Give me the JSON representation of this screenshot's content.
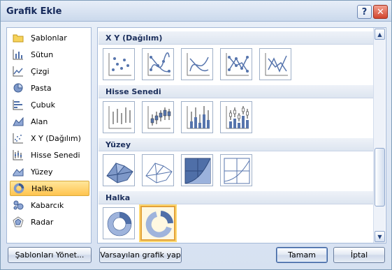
{
  "window": {
    "title": "Grafik Ekle"
  },
  "titlebar": {
    "help_glyph": "?",
    "close_glyph": "✕"
  },
  "sidebar": {
    "items": [
      {
        "label": "Şablonlar",
        "icon": "folder-icon"
      },
      {
        "label": "Sütun",
        "icon": "column-chart-icon"
      },
      {
        "label": "Çizgi",
        "icon": "line-chart-icon"
      },
      {
        "label": "Pasta",
        "icon": "pie-chart-icon"
      },
      {
        "label": "Çubuk",
        "icon": "bar-chart-icon"
      },
      {
        "label": "Alan",
        "icon": "area-chart-icon"
      },
      {
        "label": "X Y (Dağılım)",
        "icon": "scatter-chart-icon"
      },
      {
        "label": "Hisse Senedi",
        "icon": "stock-chart-icon"
      },
      {
        "label": "Yüzey",
        "icon": "surface-chart-icon"
      },
      {
        "label": "Halka",
        "icon": "doughnut-chart-icon",
        "selected": true
      },
      {
        "label": "Kabarcık",
        "icon": "bubble-chart-icon"
      },
      {
        "label": "Radar",
        "icon": "radar-chart-icon"
      }
    ]
  },
  "gallery": {
    "sections": [
      {
        "title": "X Y (Dağılım)",
        "thumbnails": [
          "scatter-markers-only",
          "scatter-smooth-lines-markers",
          "scatter-smooth-lines",
          "scatter-straight-lines-markers",
          "scatter-straight-lines"
        ]
      },
      {
        "title": "Hisse Senedi",
        "thumbnails": [
          "stock-high-low-close",
          "stock-open-high-low-close",
          "stock-volume-high-low-close",
          "stock-volume-open-high-low-close"
        ]
      },
      {
        "title": "Yüzey",
        "thumbnails": [
          "surface-3d",
          "surface-3d-wireframe",
          "surface-contour",
          "surface-contour-wireframe"
        ]
      },
      {
        "title": "Halka",
        "thumbnails": [
          "doughnut",
          "doughnut-exploded"
        ],
        "selected_index": 1
      }
    ]
  },
  "buttons": {
    "manage_templates": "Şablonları Yönet...",
    "set_default": "Varsayılan grafik yap",
    "ok": "Tamam",
    "cancel": "İptal"
  },
  "colors": {
    "selection": "#ffc44f",
    "accent": "#4f6fa8"
  }
}
